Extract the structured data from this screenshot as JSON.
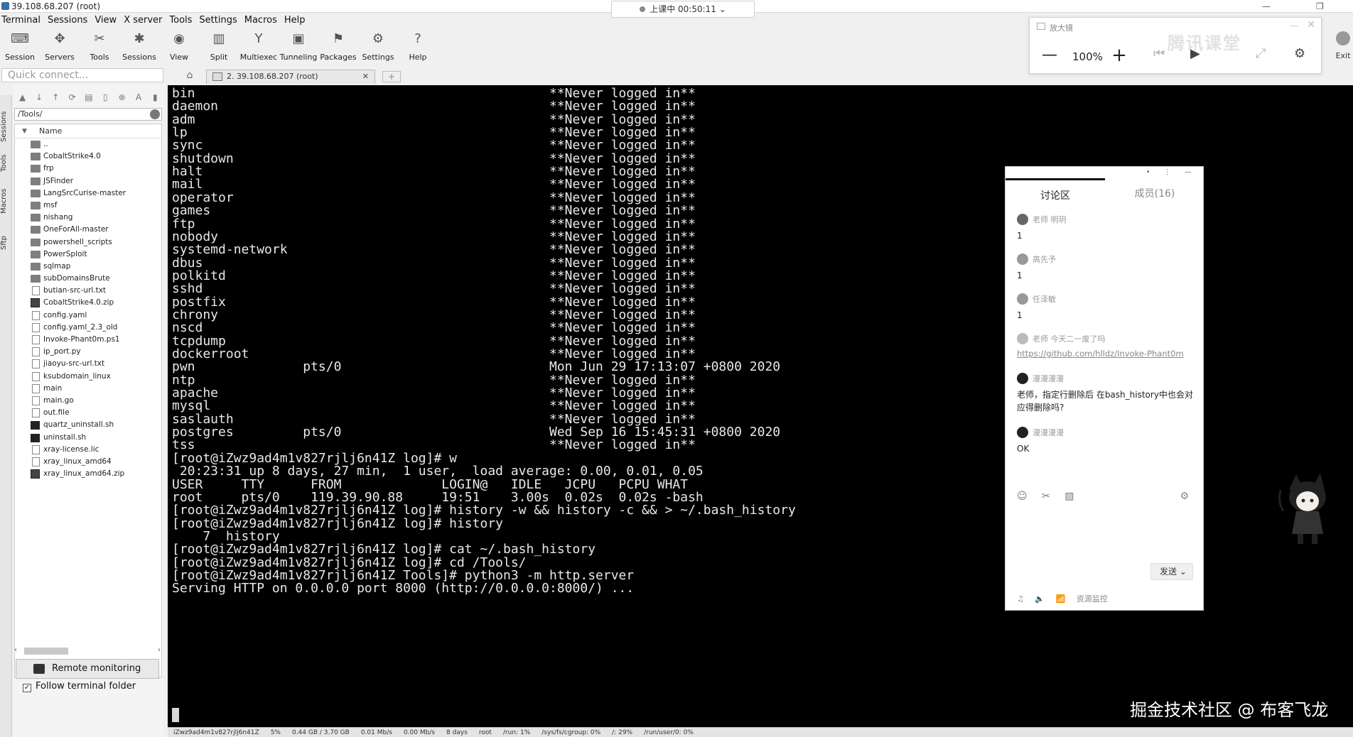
{
  "window": {
    "title": "39.108.68.207 (root)",
    "controls": [
      "—",
      "❐"
    ]
  },
  "timer": {
    "label": "上课中 00:50:11",
    "chevron": "⌄"
  },
  "menu": [
    "Terminal",
    "Sessions",
    "View",
    "X server",
    "Tools",
    "Settings",
    "Macros",
    "Help"
  ],
  "toolbar": [
    {
      "label": "Session",
      "icon": "session-icon",
      "glyph": "⌨"
    },
    {
      "label": "Servers",
      "icon": "servers-icon",
      "glyph": "✥"
    },
    {
      "label": "Tools",
      "icon": "tools-icon",
      "glyph": "✂"
    },
    {
      "label": "Sessions",
      "icon": "sessions-icon",
      "glyph": "✱"
    },
    {
      "label": "View",
      "icon": "view-icon",
      "glyph": "◉"
    },
    {
      "label": "Split",
      "icon": "split-icon",
      "glyph": "▥"
    },
    {
      "label": "Multiexec",
      "icon": "multiexec-icon",
      "glyph": "Y"
    },
    {
      "label": "Tunneling",
      "icon": "tunneling-icon",
      "glyph": "▣"
    },
    {
      "label": "Packages",
      "icon": "packages-icon",
      "glyph": "⚑"
    },
    {
      "label": "Settings",
      "icon": "settings-icon",
      "glyph": "⚙"
    },
    {
      "label": "Help",
      "icon": "help-icon",
      "glyph": "?"
    }
  ],
  "quick_connect": {
    "placeholder": "Quick connect..."
  },
  "tabs": {
    "home_glyph": "⌂",
    "active_label": "2. 39.108.68.207 (root)",
    "close": "✕",
    "new": "+"
  },
  "sidebar": {
    "vertical_tabs": [
      "Sessions",
      "Tools",
      "Macros",
      "Sftp"
    ],
    "path": "/Tools/",
    "column_name": "Name",
    "files": [
      {
        "name": "..",
        "type": "folder"
      },
      {
        "name": "CobaltStrike4.0",
        "type": "folder"
      },
      {
        "name": "frp",
        "type": "folder"
      },
      {
        "name": "JSFinder",
        "type": "folder"
      },
      {
        "name": "LangSrcCurise-master",
        "type": "folder"
      },
      {
        "name": "msf",
        "type": "folder"
      },
      {
        "name": "nishang",
        "type": "folder"
      },
      {
        "name": "OneForAll-master",
        "type": "folder"
      },
      {
        "name": "powershell_scripts",
        "type": "folder"
      },
      {
        "name": "PowerSploit",
        "type": "folder"
      },
      {
        "name": "sqlmap",
        "type": "folder"
      },
      {
        "name": "subDomainsBrute",
        "type": "folder"
      },
      {
        "name": "butian-src-url.txt",
        "type": "doc"
      },
      {
        "name": "CobaltStrike4.0.zip",
        "type": "zip"
      },
      {
        "name": "config.yaml",
        "type": "doc"
      },
      {
        "name": "config.yaml_2.3_old",
        "type": "doc"
      },
      {
        "name": "Invoke-Phant0m.ps1",
        "type": "doc"
      },
      {
        "name": "ip_port.py",
        "type": "doc"
      },
      {
        "name": "jiaoyu-src-url.txt",
        "type": "doc"
      },
      {
        "name": "ksubdomain_linux",
        "type": "doc"
      },
      {
        "name": "main",
        "type": "doc"
      },
      {
        "name": "main.go",
        "type": "doc"
      },
      {
        "name": "out.file",
        "type": "doc"
      },
      {
        "name": "quartz_uninstall.sh",
        "type": "sh"
      },
      {
        "name": "uninstall.sh",
        "type": "sh"
      },
      {
        "name": "xray-license.lic",
        "type": "doc"
      },
      {
        "name": "xray_linux_amd64",
        "type": "doc"
      },
      {
        "name": "xray_linux_amd64.zip",
        "type": "zip"
      }
    ],
    "remote_monitoring": "Remote monitoring",
    "follow_folder": "Follow terminal folder"
  },
  "terminal": {
    "lines": [
      "bin                                              **Never logged in**",
      "daemon                                           **Never logged in**",
      "adm                                              **Never logged in**",
      "lp                                               **Never logged in**",
      "sync                                             **Never logged in**",
      "shutdown                                         **Never logged in**",
      "halt                                             **Never logged in**",
      "mail                                             **Never logged in**",
      "operator                                         **Never logged in**",
      "games                                            **Never logged in**",
      "ftp                                              **Never logged in**",
      "nobody                                           **Never logged in**",
      "systemd-network                                  **Never logged in**",
      "dbus                                             **Never logged in**",
      "polkitd                                          **Never logged in**",
      "sshd                                             **Never logged in**",
      "postfix                                          **Never logged in**",
      "chrony                                           **Never logged in**",
      "nscd                                             **Never logged in**",
      "tcpdump                                          **Never logged in**",
      "dockerroot                                       **Never logged in**",
      "pwn              pts/0                           Mon Jun 29 17:13:07 +0800 2020",
      "ntp                                              **Never logged in**",
      "apache                                           **Never logged in**",
      "mysql                                            **Never logged in**",
      "saslauth                                         **Never logged in**",
      "postgres         pts/0                           Wed Sep 16 15:45:31 +0800 2020",
      "tss                                              **Never logged in**",
      "[root@iZwz9ad4m1v827rjlj6n41Z log]# w",
      " 20:23:31 up 8 days, 27 min,  1 user,  load average: 0.00, 0.01, 0.05",
      "USER     TTY      FROM             LOGIN@   IDLE   JCPU   PCPU WHAT",
      "root     pts/0    119.39.90.88     19:51    3.00s  0.02s  0.02s -bash",
      "[root@iZwz9ad4m1v827rjlj6n41Z log]# history -w && history -c && > ~/.bash_history",
      "[root@iZwz9ad4m1v827rjlj6n41Z log]# history",
      "    7  history",
      "[root@iZwz9ad4m1v827rjlj6n41Z log]# cat ~/.bash_history",
      "[root@iZwz9ad4m1v827rjlj6n41Z log]# cd /Tools/",
      "[root@iZwz9ad4m1v827rjlj6n41Z Tools]# python3 -m http.server",
      "Serving HTTP on 0.0.0.0 port 8000 (http://0.0.0.0:8000/) ..."
    ]
  },
  "statusbar": [
    "iZwz9ad4m1v827rjlj6n41Z",
    "5%",
    "0.44 GB / 3.70 GB",
    "0.01 Mb/s",
    "0.00 Mb/s",
    "8 days",
    "root",
    "/run: 1%",
    "/sys/fs/cgroup: 0%",
    "/: 29%",
    "/run/user/0: 0%"
  ],
  "zoom_panel": {
    "title": "放大镜",
    "minus": "—",
    "percent": "100%",
    "plus": "+",
    "close": "✕",
    "minimize": "—",
    "controls": [
      "⏮",
      "▶",
      "⤢",
      "⚙"
    ],
    "watermark": "腾讯课堂"
  },
  "exit": {
    "label": "Exit"
  },
  "chat": {
    "top_controls": "• ⋮ —",
    "tab_discussion": "讨论区",
    "tab_members": "成员(16)",
    "messages": [
      {
        "name": "老师  明玥",
        "text": "1"
      },
      {
        "name": "高先予",
        "text": "1"
      },
      {
        "name": "任泽敏",
        "text": "1"
      },
      {
        "name": "老师  今天二一废了吗",
        "link": "https://github.com/hlldz/Invoke-Phant0m"
      },
      {
        "name": "漫漫漫漫",
        "text": "老师，指定行删除后 在bash_history中也会对应得删除吗?"
      },
      {
        "name": "漫漫漫漫",
        "text": "OK"
      }
    ],
    "tools": [
      "☺",
      "✂",
      "▨"
    ],
    "settings_glyph": "⚙",
    "send": "发送 ⌄",
    "bottom": [
      "♫",
      "🔈",
      "📶",
      "资源监控"
    ]
  },
  "watermark": "掘金技术社区 @ 布客飞龙",
  "colors": {
    "terminal_bg": "#000000",
    "terminal_fg": "#e8e8e8",
    "accent": "#3a6ea5"
  }
}
